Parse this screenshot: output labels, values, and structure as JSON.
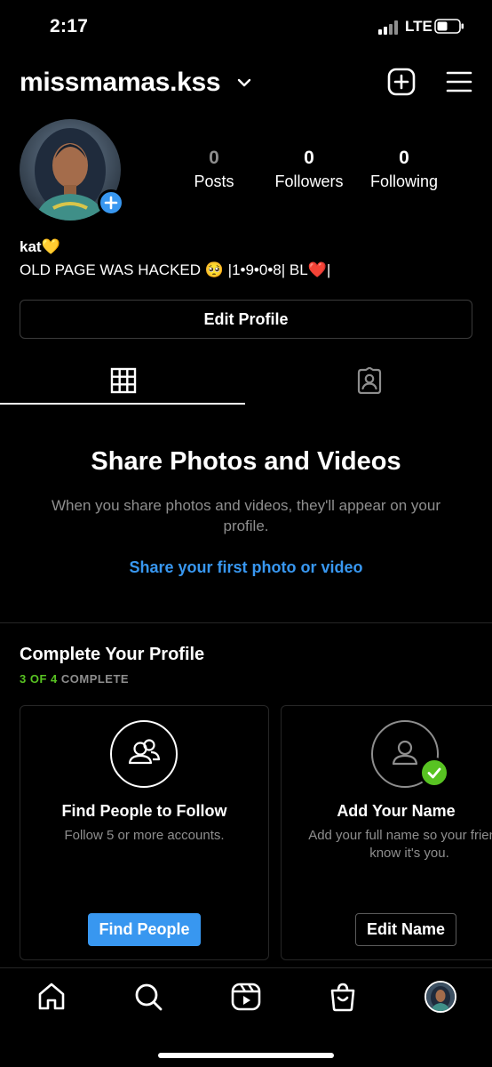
{
  "status_bar": {
    "time": "2:17",
    "network": "LTE",
    "icons": [
      "signal-icon",
      "battery-icon"
    ]
  },
  "header": {
    "username": "missmamas.kss",
    "icons": [
      "chevron-down-icon",
      "new-post-icon",
      "menu-icon"
    ]
  },
  "profile": {
    "stats": [
      {
        "value": "0",
        "label": "Posts"
      },
      {
        "value": "0",
        "label": "Followers"
      },
      {
        "value": "0",
        "label": "Following"
      }
    ],
    "name": "kat💛",
    "bio": "OLD PAGE WAS HACKED 🥺 |1•9•0•8| BL❤️|",
    "edit_profile_label": "Edit Profile"
  },
  "tabs": [
    {
      "name": "grid",
      "icon": "grid-icon",
      "active": true
    },
    {
      "name": "tagged",
      "icon": "tagged-icon",
      "active": false
    }
  ],
  "empty_state": {
    "title": "Share Photos and Videos",
    "subtitle": "When you share photos and videos, they'll appear on your profile.",
    "link": "Share your first photo or video"
  },
  "complete_profile": {
    "title": "Complete Your Profile",
    "progress_done": "3 OF 4",
    "progress_rest": " COMPLETE",
    "cards": [
      {
        "icon": "people-icon",
        "title": "Find People to Follow",
        "description": "Follow 5 or more accounts.",
        "button": "Find People",
        "completed": false
      },
      {
        "icon": "person-icon",
        "title": "Add Your Name",
        "description": "Add your full name so your friends know it's you.",
        "button": "Edit Name",
        "completed": true
      }
    ]
  },
  "bottom_nav": {
    "items": [
      "home-icon",
      "search-icon",
      "reels-icon",
      "shop-icon",
      "profile-avatar"
    ]
  },
  "colors": {
    "background": "#000000",
    "accent_blue": "#3897f0",
    "success_green": "#58c322",
    "muted_text": "#8e8e8e"
  }
}
